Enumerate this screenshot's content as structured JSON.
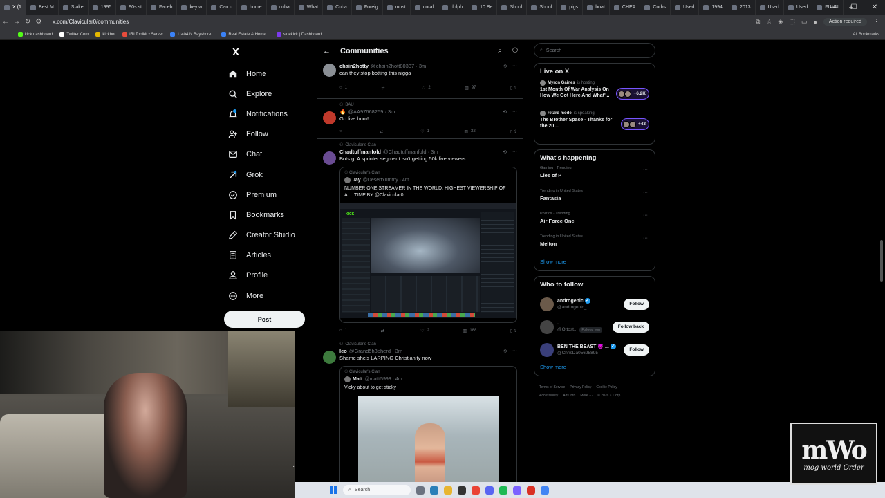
{
  "browser": {
    "tabs": [
      {
        "label": "X (1"
      },
      {
        "label": "Best M"
      },
      {
        "label": "Stake"
      },
      {
        "label": "1995"
      },
      {
        "label": "90s st"
      },
      {
        "label": "Faceb"
      },
      {
        "label": "key w"
      },
      {
        "label": "Can u"
      },
      {
        "label": "home"
      },
      {
        "label": "cuba"
      },
      {
        "label": "What"
      },
      {
        "label": "Cuba"
      },
      {
        "label": "Foreig"
      },
      {
        "label": "most"
      },
      {
        "label": "coral"
      },
      {
        "label": "dolph"
      },
      {
        "label": "10 Be"
      },
      {
        "label": "Shoul"
      },
      {
        "label": "Shoul"
      },
      {
        "label": "pigs"
      },
      {
        "label": "boat"
      },
      {
        "label": "CHEA"
      },
      {
        "label": "Curbs"
      },
      {
        "label": "Used"
      },
      {
        "label": "1994"
      },
      {
        "label": "2013"
      },
      {
        "label": "Used"
      },
      {
        "label": "Used"
      },
      {
        "label": "FUNN"
      }
    ],
    "new_tab": "+",
    "url": "x.com/Clavicular0/communities",
    "action_required": "Action required",
    "bookmarks": [
      {
        "label": "kick dashboard"
      },
      {
        "label": "Twitter Com"
      },
      {
        "label": "kickbot"
      },
      {
        "label": "IRLToolkit • Server"
      },
      {
        "label": "11404 N Bayshore..."
      },
      {
        "label": "Real Estate & Home..."
      },
      {
        "label": "sidekick | Dashboard"
      }
    ],
    "all_bookmarks": "All Bookmarks"
  },
  "nav": {
    "logo": "X",
    "items": [
      {
        "label": "Home"
      },
      {
        "label": "Explore"
      },
      {
        "label": "Notifications"
      },
      {
        "label": "Follow"
      },
      {
        "label": "Chat"
      },
      {
        "label": "Grok"
      },
      {
        "label": "Premium"
      },
      {
        "label": "Bookmarks"
      },
      {
        "label": "Creator Studio"
      },
      {
        "label": "Articles"
      },
      {
        "label": "Profile"
      },
      {
        "label": "More"
      }
    ],
    "post_label": "Post"
  },
  "header": {
    "title": "Communities"
  },
  "tweets": [
    {
      "clan": "",
      "name": "chain2hotty",
      "handle": "@chain2hott80337 · 3m",
      "text": "can they stop botting this nigga",
      "reply": "1",
      "repost": "",
      "like": "2",
      "views": "97",
      "avatar_color": "#8a8f95"
    },
    {
      "clan": "BAU",
      "name": "",
      "handle": "@AA97668259 · 3m",
      "text": "Go live bum!",
      "reply": "",
      "repost": "",
      "like": "1",
      "views": "32",
      "avatar_color": "#c0392b"
    },
    {
      "clan": "Clavicular's Clan",
      "name": "Chadtuffmanfold",
      "handle": "@Chadtuffmanfold · 3m",
      "text": "Bots g. A sprinter segment isn't getting 50k live viewers",
      "reply": "1",
      "repost": "",
      "like": "2",
      "views": "188",
      "avatar_color": "#6a4c93",
      "quote": {
        "clan": "Clavicular's Clan",
        "name": "Jay",
        "handle": "@DesertYummy · 4m",
        "text": "NUMBER ONE STREAMER IN THE WORLD. HIGHEST VIEWERSHIP OF ALL TIME BY @Clavicular0",
        "media_label": "KICK"
      }
    },
    {
      "clan": "Clavicular's Clan",
      "name": "leo",
      "handle": "@Grand5h3pherd · 3m",
      "text": "Shame she's LARPING Christianity now",
      "avatar_color": "#3d7a3d",
      "quote": {
        "clan": "Clavicular's Clan",
        "name": "Matt",
        "handle": "@mattt5993 · 4m",
        "text": "Vicky about to get sticky"
      }
    }
  ],
  "right": {
    "search_placeholder": "Search",
    "live": {
      "title": "Live on X",
      "items": [
        {
          "host": "Myron Gaines",
          "status": "is hosting",
          "title": "1st Month Of War Analysis On How We Got Here And What'...",
          "count": "+6.2K"
        },
        {
          "host": "retard mode",
          "status": "is speaking",
          "title": "The Brother Space - Thanks for the 20 ...",
          "count": "+43"
        }
      ]
    },
    "happening": {
      "title": "What's happening",
      "trends": [
        {
          "context": "Gaming · Trending",
          "name": "Lies of P"
        },
        {
          "context": "Trending in United States",
          "name": "Fantasia"
        },
        {
          "context": "Politics · Trending",
          "name": "Air Force One"
        },
        {
          "context": "Trending in United States",
          "name": "Melton"
        }
      ],
      "show_more": "Show more"
    },
    "who_to_follow": {
      "title": "Who to follow",
      "people": [
        {
          "name": "androgenic",
          "handle": "@androgenic_",
          "button": "Follow",
          "follows_you": ""
        },
        {
          "name": ".",
          "handle": "@Ottost...",
          "button": "Follow back",
          "follows_you": "Follows you"
        },
        {
          "name": "BEN THE BEAST 😈 ...",
          "handle": "@ChrisDa05695895",
          "button": "Follow",
          "follows_you": ""
        }
      ],
      "show_more": "Show more"
    },
    "footer": [
      "Terms of Service",
      "Privacy Policy",
      "Cookie Policy",
      "Accessibility",
      "Ads info",
      "More ···",
      "© 2026 X Corp."
    ]
  },
  "taskbar": {
    "search_placeholder": "Search"
  },
  "overlay_logo": {
    "big": "mWo",
    "small": "mog world Order"
  },
  "colors": {
    "accent": "#1d9bf0",
    "background": "#000000",
    "border": "#2f3336",
    "muted": "#71767b",
    "live_purple": "#7856ff"
  }
}
